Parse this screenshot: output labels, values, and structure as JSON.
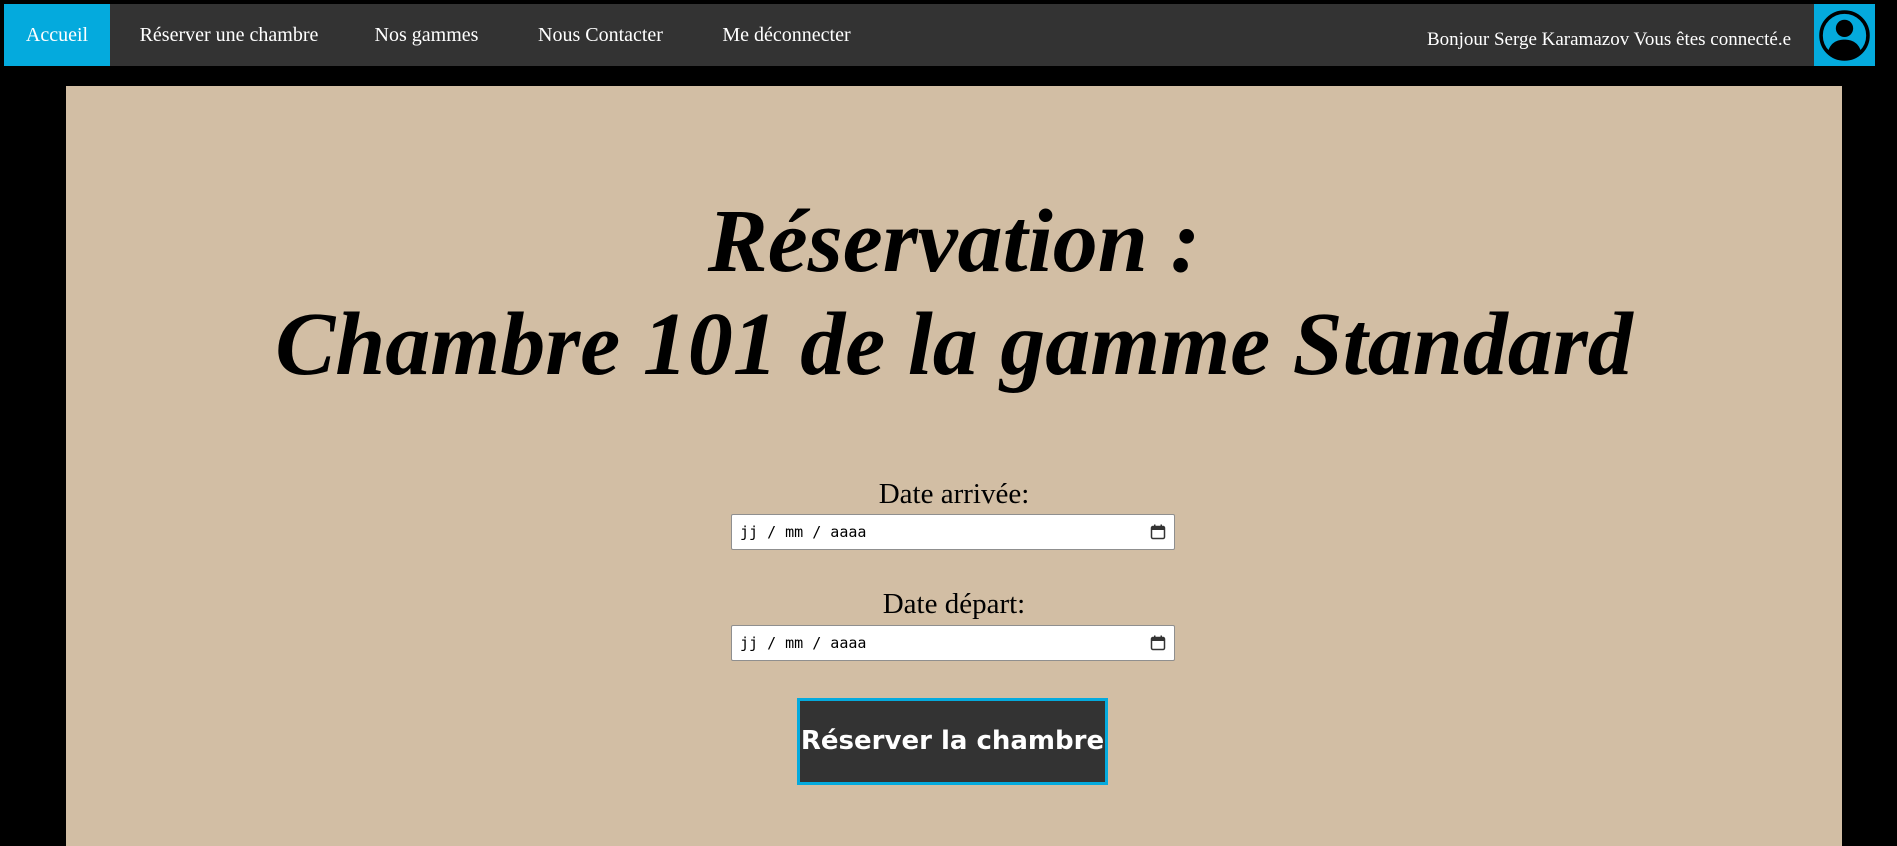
{
  "nav": {
    "items": [
      {
        "label": "Accueil",
        "active": true
      },
      {
        "label": "Réserver une chambre",
        "active": false
      },
      {
        "label": "Nos gammes",
        "active": false
      },
      {
        "label": "Nous Contacter",
        "active": false
      },
      {
        "label": "Me déconnecter",
        "active": false
      }
    ],
    "greeting": "Bonjour Serge Karamazov Vous êtes connecté.e",
    "avatar_icon": "user-circle-icon"
  },
  "main": {
    "title_line1": "Réservation :",
    "title_line2": "Chambre 101 de la gamme Standard",
    "form": {
      "arrival_label": "Date arrivée:",
      "arrival_value": "jj / mm / aaaa",
      "departure_label": "Date départ:",
      "departure_value": "jj / mm / aaaa",
      "calendar_icon": "calendar-icon",
      "submit_label": "Réserver la chambre"
    }
  },
  "colors": {
    "accent": "#04AADD",
    "nav_background": "#333333",
    "panel_background": "#D2BEA4",
    "page_background": "#000000"
  }
}
